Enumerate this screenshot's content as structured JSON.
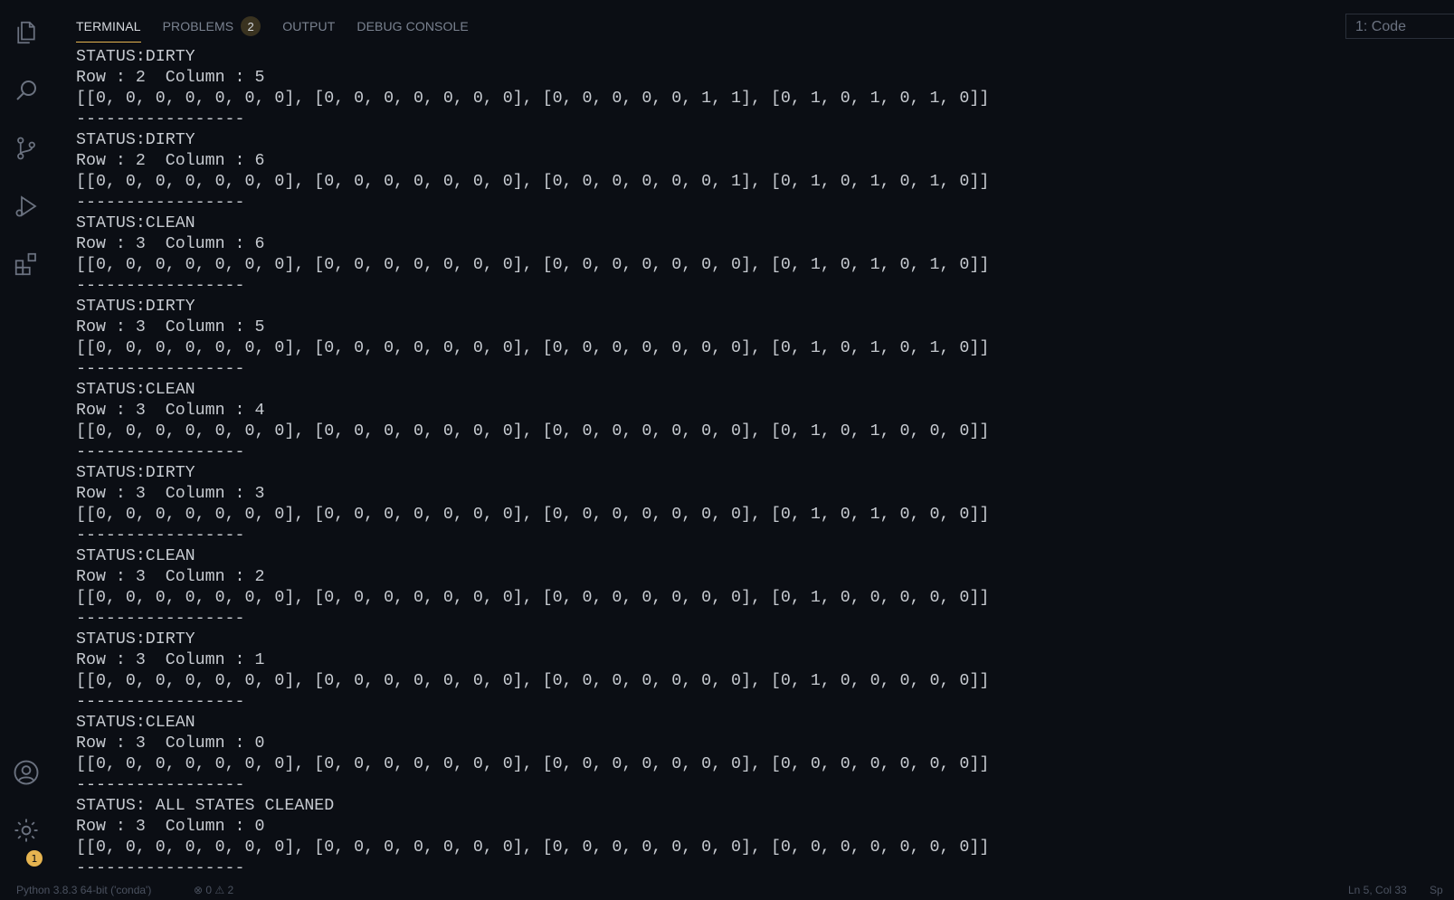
{
  "panel": {
    "tabs": [
      {
        "label": "TERMINAL",
        "active": true
      },
      {
        "label": "PROBLEMS",
        "active": false,
        "badge": "2"
      },
      {
        "label": "OUTPUT",
        "active": false
      },
      {
        "label": "DEBUG CONSOLE",
        "active": false
      }
    ],
    "terminal_selector": "1: Code"
  },
  "activity_bar": {
    "icons": [
      "explorer-icon",
      "search-icon",
      "source-control-icon",
      "run-debug-icon",
      "extensions-icon",
      "account-icon",
      "settings-gear-icon"
    ],
    "settings_badge": "1"
  },
  "terminal": {
    "lines": [
      "STATUS:DIRTY",
      "Row : 2  Column : 5",
      "[[0, 0, 0, 0, 0, 0, 0], [0, 0, 0, 0, 0, 0, 0], [0, 0, 0, 0, 0, 1, 1], [0, 1, 0, 1, 0, 1, 0]]",
      "-----------------",
      "STATUS:DIRTY",
      "Row : 2  Column : 6",
      "[[0, 0, 0, 0, 0, 0, 0], [0, 0, 0, 0, 0, 0, 0], [0, 0, 0, 0, 0, 0, 1], [0, 1, 0, 1, 0, 1, 0]]",
      "-----------------",
      "STATUS:CLEAN",
      "Row : 3  Column : 6",
      "[[0, 0, 0, 0, 0, 0, 0], [0, 0, 0, 0, 0, 0, 0], [0, 0, 0, 0, 0, 0, 0], [0, 1, 0, 1, 0, 1, 0]]",
      "-----------------",
      "STATUS:DIRTY",
      "Row : 3  Column : 5",
      "[[0, 0, 0, 0, 0, 0, 0], [0, 0, 0, 0, 0, 0, 0], [0, 0, 0, 0, 0, 0, 0], [0, 1, 0, 1, 0, 1, 0]]",
      "-----------------",
      "STATUS:CLEAN",
      "Row : 3  Column : 4",
      "[[0, 0, 0, 0, 0, 0, 0], [0, 0, 0, 0, 0, 0, 0], [0, 0, 0, 0, 0, 0, 0], [0, 1, 0, 1, 0, 0, 0]]",
      "-----------------",
      "STATUS:DIRTY",
      "Row : 3  Column : 3",
      "[[0, 0, 0, 0, 0, 0, 0], [0, 0, 0, 0, 0, 0, 0], [0, 0, 0, 0, 0, 0, 0], [0, 1, 0, 1, 0, 0, 0]]",
      "-----------------",
      "STATUS:CLEAN",
      "Row : 3  Column : 2",
      "[[0, 0, 0, 0, 0, 0, 0], [0, 0, 0, 0, 0, 0, 0], [0, 0, 0, 0, 0, 0, 0], [0, 1, 0, 0, 0, 0, 0]]",
      "-----------------",
      "STATUS:DIRTY",
      "Row : 3  Column : 1",
      "[[0, 0, 0, 0, 0, 0, 0], [0, 0, 0, 0, 0, 0, 0], [0, 0, 0, 0, 0, 0, 0], [0, 1, 0, 0, 0, 0, 0]]",
      "-----------------",
      "STATUS:CLEAN",
      "Row : 3  Column : 0",
      "[[0, 0, 0, 0, 0, 0, 0], [0, 0, 0, 0, 0, 0, 0], [0, 0, 0, 0, 0, 0, 0], [0, 0, 0, 0, 0, 0, 0]]",
      "-----------------",
      "STATUS: ALL STATES CLEANED",
      "Row : 3  Column : 0",
      "[[0, 0, 0, 0, 0, 0, 0], [0, 0, 0, 0, 0, 0, 0], [0, 0, 0, 0, 0, 0, 0], [0, 0, 0, 0, 0, 0, 0]]",
      "-----------------"
    ]
  },
  "status_bar": {
    "interpreter": "Python 3.8.3 64-bit ('conda')",
    "problems": "⊗ 0  ⚠ 2",
    "cursor": "Ln 5, Col 33",
    "spaces": "Sp"
  }
}
